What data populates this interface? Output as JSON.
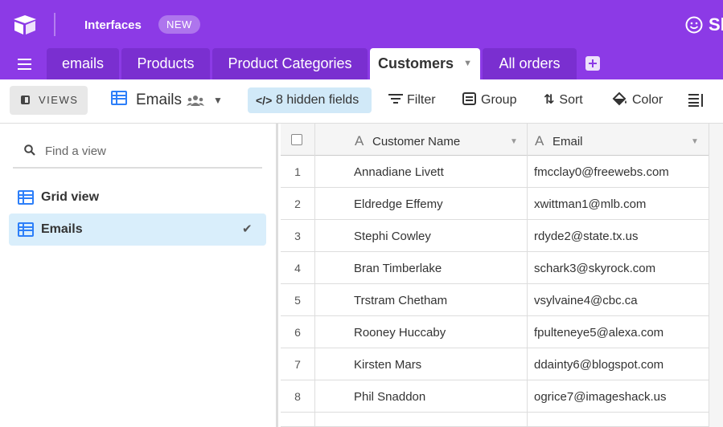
{
  "topbar": {
    "logo_icon": "airtable-logo-icon",
    "interfaces_label": "Interfaces",
    "new_badge": "NEW",
    "help_icon": "smiley-icon",
    "help_text": "Sh"
  },
  "tabs": {
    "menu_icon": "hamburger-menu-icon",
    "items": [
      {
        "label": "emails",
        "active": false
      },
      {
        "label": "Products",
        "active": false
      },
      {
        "label": "Product Categories",
        "active": false
      },
      {
        "label": "Customers",
        "active": true
      },
      {
        "label": "All orders",
        "active": false
      }
    ],
    "add_icon": "plus-square-icon"
  },
  "toolbar": {
    "views_label": "VIEWS",
    "current_view": "Emails",
    "hidden_fields": "8 hidden fields",
    "filter": "Filter",
    "group": "Group",
    "sort": "Sort",
    "color": "Color"
  },
  "sidebar": {
    "search_placeholder": "Find a view",
    "views": [
      {
        "label": "Grid view",
        "selected": false
      },
      {
        "label": "Emails",
        "selected": true
      }
    ]
  },
  "grid": {
    "columns": [
      "Customer Name",
      "Email"
    ],
    "rows": [
      {
        "num": "1",
        "name": "Annadiane Livett",
        "email": "fmcclay0@freewebs.com"
      },
      {
        "num": "2",
        "name": "Eldredge Effemy",
        "email": "xwittman1@mlb.com"
      },
      {
        "num": "3",
        "name": "Stephi Cowley",
        "email": "rdyde2@state.tx.us"
      },
      {
        "num": "4",
        "name": "Bran Timberlake",
        "email": "schark3@skyrock.com"
      },
      {
        "num": "5",
        "name": "Trstram Chetham",
        "email": "vsylvaine4@cbc.ca"
      },
      {
        "num": "6",
        "name": "Rooney Huccaby",
        "email": "fpulteneye5@alexa.com"
      },
      {
        "num": "7",
        "name": "Kirsten Mars",
        "email": "ddainty6@blogspot.com"
      },
      {
        "num": "8",
        "name": "Phil Snaddon",
        "email": "ogrice7@imageshack.us"
      }
    ]
  },
  "colors": {
    "brand": "#8c3ae6",
    "accent": "#2d7ff9",
    "selected_bg": "#d9eefb"
  }
}
